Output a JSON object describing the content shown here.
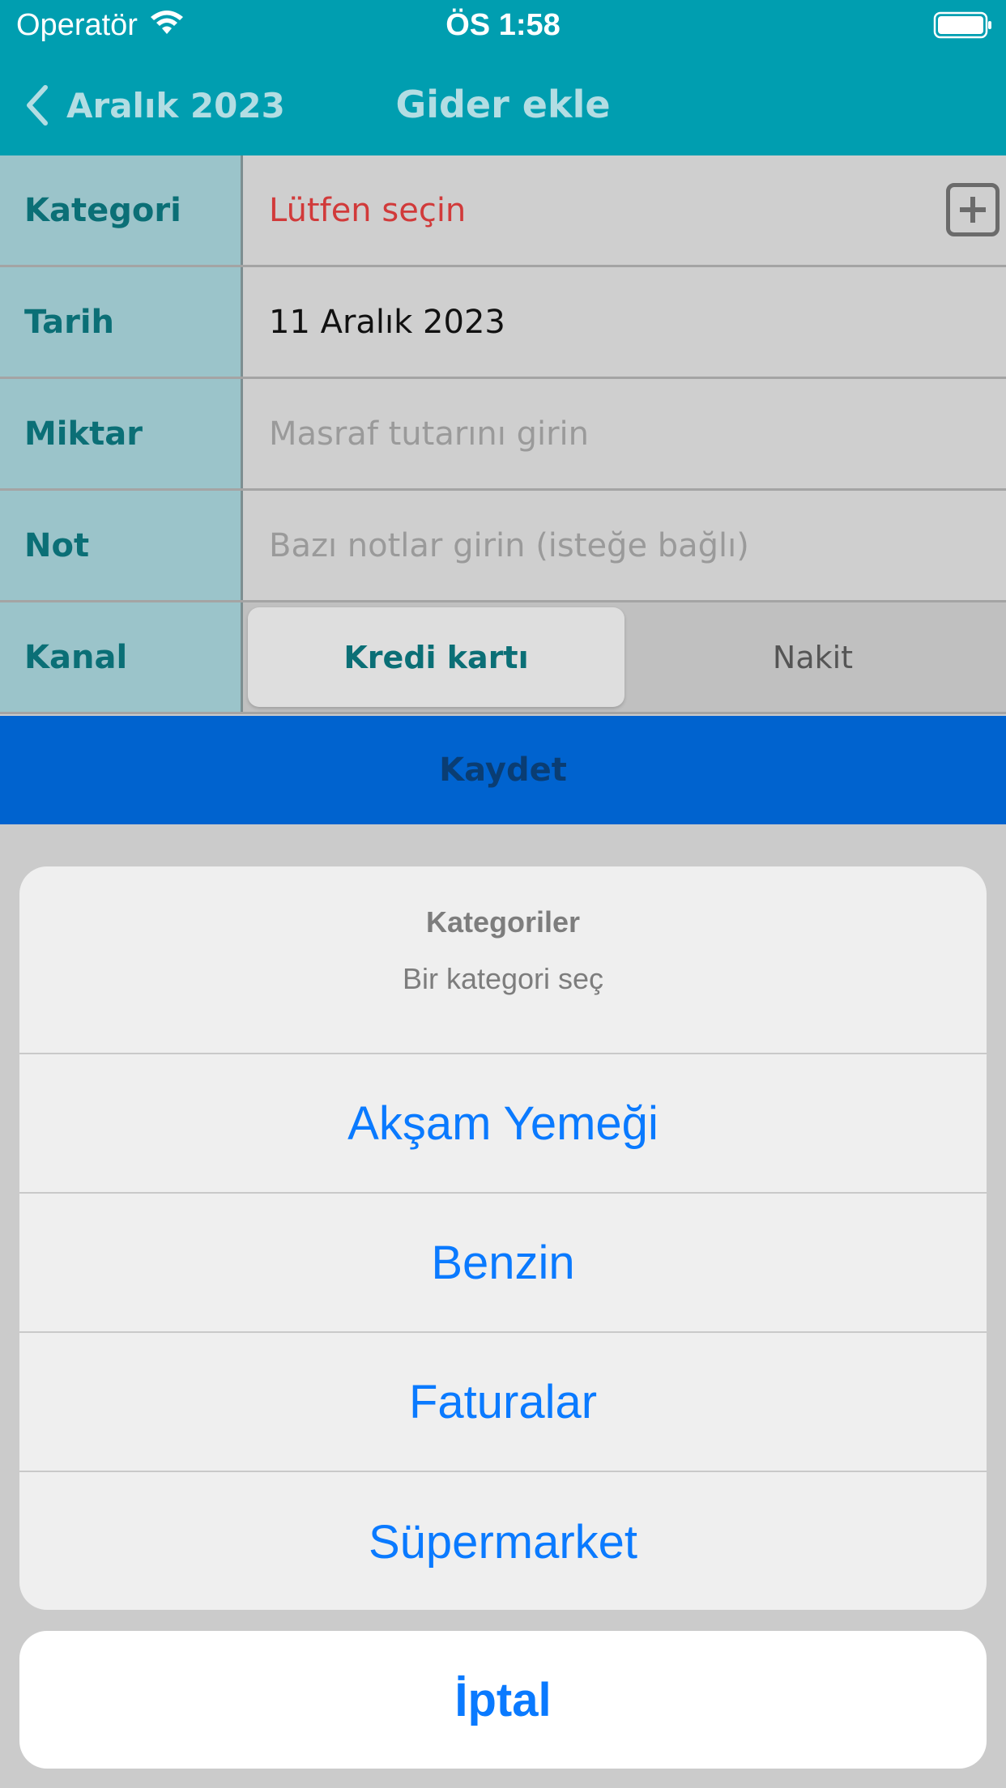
{
  "status_bar": {
    "carrier": "Operatör",
    "time": "ÖS 1:58",
    "wifi_icon": "wifi-icon",
    "battery_icon": "battery-full-icon"
  },
  "nav": {
    "back_label": "Aralık 2023",
    "title": "Gider ekle"
  },
  "form": {
    "category": {
      "label": "Kategori",
      "value": "Lütfen seçin"
    },
    "date": {
      "label": "Tarih",
      "value": "11 Aralık 2023"
    },
    "amount": {
      "label": "Miktar",
      "placeholder": "Masraf tutarını girin"
    },
    "note": {
      "label": "Not",
      "placeholder": "Bazı notlar girin (isteğe bağlı)"
    },
    "channel": {
      "label": "Kanal",
      "options": [
        "Kredi kartı",
        "Nakit"
      ],
      "selected": "Kredi kartı"
    },
    "save_label": "Kaydet"
  },
  "action_sheet": {
    "title": "Kategoriler",
    "subtitle": "Bir kategori seç",
    "items": [
      "Akşam Yemeği",
      "Benzin",
      "Faturalar",
      "Süpermarket"
    ],
    "cancel_label": "İptal"
  },
  "colors": {
    "nav_background": "#009eb0",
    "accent_blue": "#0a7aff",
    "save_bar": "#0063cf",
    "label_text": "#0b6f76",
    "required_text": "#d13a3a"
  }
}
